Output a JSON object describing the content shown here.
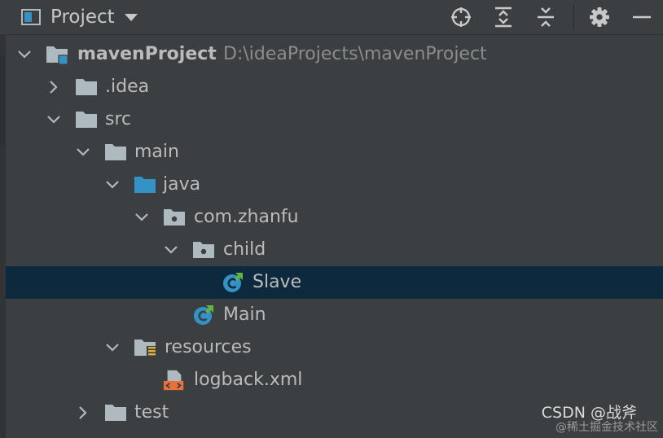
{
  "toolbar": {
    "title": "Project",
    "icons": [
      "project-window-icon",
      "caret-down-icon",
      "locate-icon",
      "expand-all-icon",
      "collapse-all-icon",
      "gear-icon",
      "hide-icon"
    ]
  },
  "tree": {
    "root_label": "mavenProject",
    "root_path": "D:\\ideaProjects\\mavenProject",
    "idea_label": ".idea",
    "src_label": "src",
    "main_label": "main",
    "java_label": "java",
    "pkg_label": "com.zhanfu",
    "child_label": "child",
    "slave_label": "Slave",
    "mainclass_label": "Main",
    "resources_label": "resources",
    "logback_label": "logback.xml",
    "test_label": "test",
    "selected": "Slave"
  },
  "watermark": {
    "line1": "CSDN @战斧",
    "line2": "@稀土掘金技术社区"
  },
  "colors": {
    "panel_bg": "#3c3f41",
    "selection_bg": "#0d293e",
    "text": "#bbbbbb",
    "path_text": "#8c8c8c",
    "folder_gray": "#aeb9c0",
    "folder_blue": "#3592c4",
    "class_circle": "#3592c4",
    "green_arrow": "#62b543",
    "xml_orange": "#e8713a"
  }
}
